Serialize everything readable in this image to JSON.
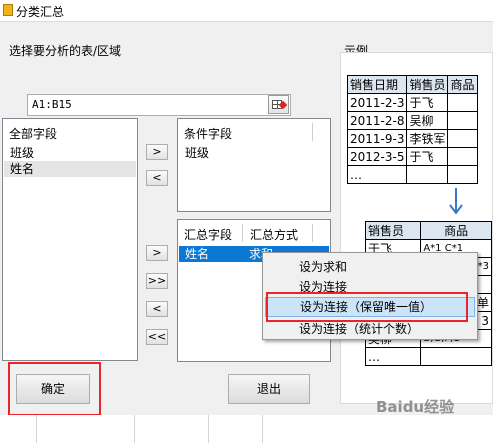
{
  "window": {
    "title": "分类汇总"
  },
  "range": {
    "label": "选择要分析的表/区域",
    "value": "A1:B15"
  },
  "example": {
    "label": "示例",
    "table1": {
      "headers": [
        "销售日期",
        "销售员",
        "商品"
      ],
      "rows": [
        [
          "2011-2-3",
          "于飞",
          ""
        ],
        [
          "2011-2-8",
          "吴柳",
          ""
        ],
        [
          "2011-9-3",
          "李铁军",
          ""
        ],
        [
          "2012-3-5",
          "于飞",
          ""
        ],
        [
          "…",
          "",
          ""
        ]
      ]
    },
    "table2": {
      "headers": [
        "销售员",
        "商品"
      ],
      "rows": [
        [
          "于飞",
          "A*1 C*1"
        ],
        [
          "",
          "G*3"
        ],
        [
          "",
          ""
        ],
        [
          "",
          "名",
          "单"
        ],
        [
          "",
          "",
          "3"
        ],
        [
          "吴柳",
          "B,G,F,1"
        ],
        [
          "…",
          ""
        ]
      ]
    }
  },
  "all_fields": {
    "header": "全部字段",
    "items": [
      "班级",
      "姓名"
    ]
  },
  "condition_fields": {
    "header": "条件字段",
    "items": [
      "班级"
    ]
  },
  "summary": {
    "col_field": "汇总字段",
    "col_method": "汇总方式",
    "rows": [
      {
        "field": "姓名",
        "method": "求和"
      }
    ]
  },
  "arrows": {
    "right": ">",
    "left": "<",
    "all_right": ">>",
    "all_left": "<<"
  },
  "buttons": {
    "ok": "确定",
    "exit": "退出"
  },
  "context_menu": {
    "items": [
      "设为求和",
      "设为连接",
      "设为连接（保留唯一值）",
      "设为连接（统计个数）"
    ],
    "highlighted_index": 2
  },
  "watermark": "Baidu经验"
}
